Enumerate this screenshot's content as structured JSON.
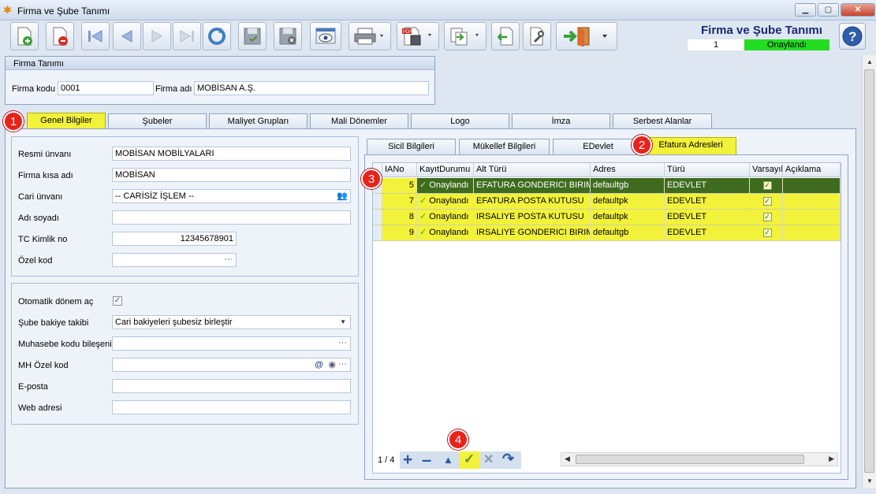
{
  "window": {
    "title": "Firma ve Şube Tanımı"
  },
  "header": {
    "title": "Firma ve Şube Tanımı",
    "record_no": "1",
    "status": "Onaylandı"
  },
  "firma": {
    "panel_title": "Firma Tanımı",
    "kod_label": "Firma kodu",
    "kod_value": "0001",
    "adi_label": "Firma adı",
    "adi_value": "MOBİSAN A.Ş."
  },
  "main_tabs": [
    "Genel Bilgiler",
    "Şubeler",
    "Maliyet Grupları",
    "Mali Dönemler",
    "Logo",
    "İmza",
    "Serbest Alanlar"
  ],
  "general": {
    "resmi_label": "Resmi ünvanı",
    "resmi_value": "MOBİSAN MOBİLYALARI",
    "kisa_label": "Firma kısa adı",
    "kisa_value": "MOBİSAN",
    "cari_label": "Cari ünvanı",
    "cari_value": "-- CARİSİZ İŞLEM --",
    "adsoyad_label": "Adı soyadı",
    "adsoyad_value": "",
    "tc_label": "TC Kimlik no",
    "tc_value": "12345678901",
    "ozel_label": "Özel kod",
    "ozel_value": ""
  },
  "options": {
    "otomatik_label": "Otomatik dönem aç",
    "sube_label": "Şube bakiye takibi",
    "sube_value": "Cari bakiyeleri şubesiz birleştir",
    "muh_label": "Muhasebe kodu bileşeni",
    "muh_value": "",
    "mh_label": "MH Özel kod",
    "mh_value": "",
    "eposta_label": "E-posta",
    "eposta_value": "",
    "web_label": "Web adresi",
    "web_value": ""
  },
  "sub_tabs": [
    "Sicil Bilgileri",
    "Mükellef Bilgileri",
    "EDevlet",
    "Efatura Adresleri"
  ],
  "grid": {
    "columns": [
      "IANo",
      "KayıtDurumu",
      "Alt Türü",
      "Adres",
      "Türü",
      "Varsayıl",
      "Açıklama"
    ],
    "rows": [
      {
        "no": "5",
        "durum": "Onaylandı",
        "alt": "EFATURA GONDERICI BIRIM",
        "adres": "defaultgb",
        "turu": "EDEVLET"
      },
      {
        "no": "7",
        "durum": "Onaylandı",
        "alt": "EFATURA POSTA KUTUSU",
        "adres": "defaultpk",
        "turu": "EDEVLET"
      },
      {
        "no": "8",
        "durum": "Onaylandı",
        "alt": "IRSALIYE POSTA KUTUSU",
        "adres": "defaultpk",
        "turu": "EDEVLET"
      },
      {
        "no": "9",
        "durum": "Onaylandı",
        "alt": "IRSALIYE GONDERICI BIRIM",
        "adres": "defaultgb",
        "turu": "EDEVLET"
      }
    ],
    "pager": "1 / 4"
  },
  "badges": [
    "1",
    "2",
    "3",
    "4"
  ],
  "colors": {
    "highlight": "#f2f23a",
    "selected_row": "#3e6b1e",
    "status_green": "#22dd22"
  }
}
